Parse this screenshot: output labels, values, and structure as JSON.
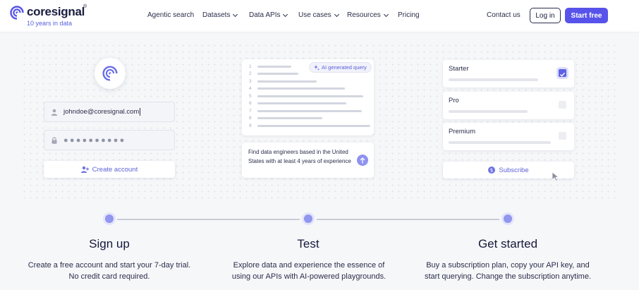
{
  "brand": {
    "name": "coresignal",
    "reg": "®",
    "tagline": "10 years in data",
    "accent": "#5753ea"
  },
  "nav": {
    "items": [
      {
        "label": "Agentic search",
        "dropdown": false
      },
      {
        "label": "Datasets",
        "dropdown": true
      },
      {
        "label": "Data APIs",
        "dropdown": true
      },
      {
        "label": "Use cases",
        "dropdown": true
      },
      {
        "label": "Resources",
        "dropdown": true
      },
      {
        "label": "Pricing",
        "dropdown": false
      }
    ],
    "contact": "Contact us",
    "login": "Log in",
    "start": "Start free"
  },
  "signup_card": {
    "email_value": "johndoe@coresignal.com",
    "password_mask": "●●●●●●●●●●",
    "create_label": "Create account"
  },
  "test_card": {
    "line_numbers": [
      "1",
      "2",
      "3",
      "4",
      "5",
      "6",
      "7",
      "8",
      "9"
    ],
    "ai_badge": "AI generated query",
    "prompt": "Find data engineers based in the United States with at least 4 years of experience"
  },
  "plans": {
    "items": [
      {
        "name": "Starter",
        "selected": true
      },
      {
        "name": "Pro",
        "selected": false
      },
      {
        "name": "Premium",
        "selected": false
      }
    ],
    "subscribe_label": "Subscribe"
  },
  "steps": [
    {
      "title": "Sign up",
      "desc_lines": [
        "Create a free account and start your 7-day trial.",
        "No credit card required."
      ]
    },
    {
      "title": "Test",
      "desc_lines": [
        "Explore data and experience the essence of",
        "using our APIs with AI-powered playgrounds."
      ]
    },
    {
      "title": "Get started",
      "desc_lines": [
        "Buy a subscription plan, copy your API key, and",
        "start querying. Change the subscription anytime."
      ]
    }
  ]
}
